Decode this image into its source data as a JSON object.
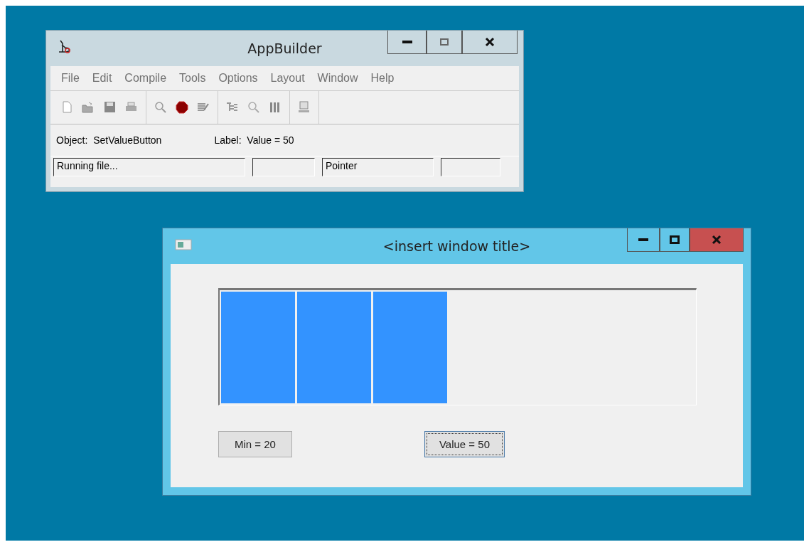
{
  "appbuilder_window": {
    "title": "AppBuilder",
    "menu": [
      "File",
      "Edit",
      "Compile",
      "Tools",
      "Options",
      "Layout",
      "Window",
      "Help"
    ],
    "object_label": "Object:",
    "object_value": "SetValueButton",
    "label_label": "Label:",
    "label_value": "Value = 50",
    "status_bar": [
      "Running file...",
      "Pointer"
    ]
  },
  "runtime_window": {
    "title": "<insert window title>",
    "progress": {
      "level": 0.48
    },
    "buttons": [
      {
        "label": "Min = 20",
        "focused": false
      },
      {
        "label": "Value = 50",
        "focused": true
      }
    ]
  }
}
